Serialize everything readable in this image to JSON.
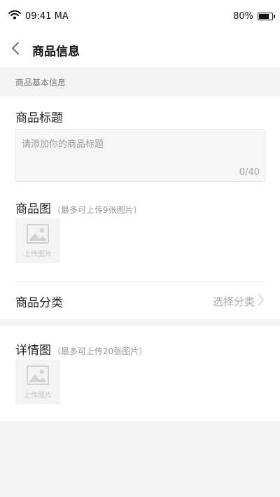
{
  "status_bar": {
    "time": "09:41 MA",
    "battery": "80%",
    "battery_level": 0.8,
    "icons": [
      "wifi-icon",
      "battery-icon"
    ]
  },
  "nav": {
    "title": "商品信息",
    "back_icon": "chevron-left-icon"
  },
  "section": {
    "title": "商品基本信息"
  },
  "product_title": {
    "label": "商品标题",
    "value": "",
    "placeholder": "请添加你的商品标题",
    "count": "0/40"
  },
  "product_images": {
    "label": "商品图",
    "hint": "（最多可上传9张图片）",
    "upload_label": "上传图片",
    "icon": "image-icon"
  },
  "category": {
    "label": "商品分类",
    "value": "选择分类",
    "icon": "chevron-right-icon"
  },
  "detail_images": {
    "label": "详情图",
    "hint": "（最多可上传20张图片）",
    "upload_label": "上传图片",
    "icon": "image-icon"
  },
  "colors": {
    "background": "#f4f4f4",
    "card": "#ffffff",
    "text": "#222222",
    "muted": "#999999",
    "input_bg": "#f6f6f6"
  }
}
